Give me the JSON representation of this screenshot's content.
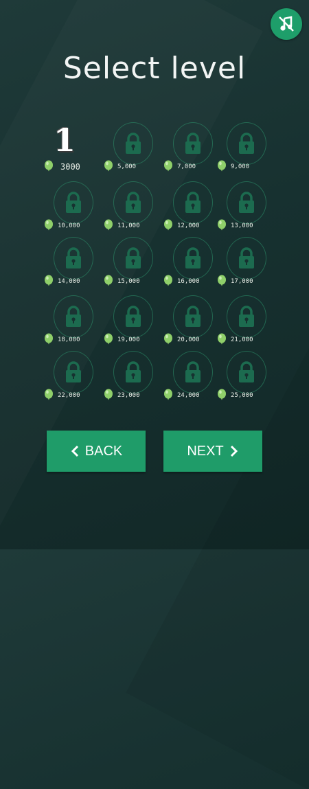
{
  "header": {
    "title": "Select level",
    "music_icon": "music-off-icon"
  },
  "levels": [
    {
      "level": "1",
      "score": "3000",
      "locked": false
    },
    {
      "score": "5,000",
      "locked": true
    },
    {
      "score": "7,000",
      "locked": true
    },
    {
      "score": "9,000",
      "locked": true
    },
    {
      "score": "10,000",
      "locked": true
    },
    {
      "score": "11,000",
      "locked": true
    },
    {
      "score": "12,000",
      "locked": true
    },
    {
      "score": "13,000",
      "locked": true
    },
    {
      "score": "14,000",
      "locked": true
    },
    {
      "score": "15,000",
      "locked": true
    },
    {
      "score": "16,000",
      "locked": true
    },
    {
      "score": "17,000",
      "locked": true
    },
    {
      "score": "18,000",
      "locked": true
    },
    {
      "score": "19,000",
      "locked": true
    },
    {
      "score": "20,000",
      "locked": true
    },
    {
      "score": "21,000",
      "locked": true
    },
    {
      "score": "22,000",
      "locked": true
    },
    {
      "score": "23,000",
      "locked": true
    },
    {
      "score": "24,000",
      "locked": true
    },
    {
      "score": "25,000",
      "locked": true
    }
  ],
  "buttons": {
    "back_label": "BACK",
    "next_label": "NEXT"
  },
  "colors": {
    "accent": "#1f9c69",
    "lock": "#1c6b4f",
    "balloon": "#8fcf6a"
  }
}
